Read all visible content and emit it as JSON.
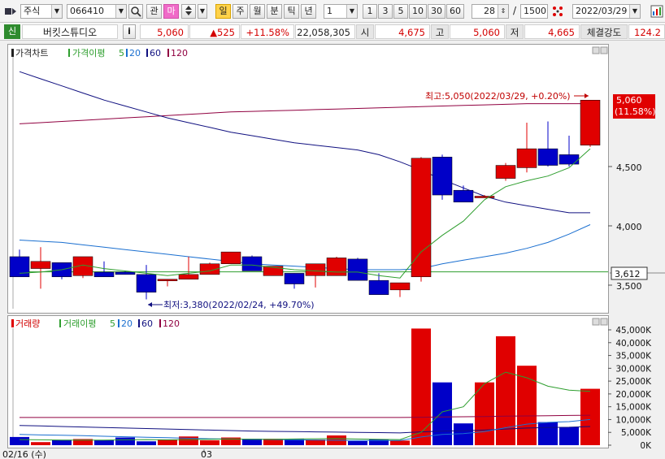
{
  "toolbar": {
    "market": "주식",
    "code": "066410",
    "btn_gwan": "관",
    "btn_ma": "마",
    "btn_day": "일",
    "btn_week": "주",
    "btn_month": "월",
    "btn_min": "분",
    "btn_tick": "틱",
    "btn_year": "년",
    "period_select": "1",
    "periods": [
      "1",
      "3",
      "5",
      "10",
      "30",
      "60"
    ],
    "count": "28",
    "slash": "/",
    "total": "1500",
    "date": "2022/03/29"
  },
  "info": {
    "badge": "신",
    "name": "버킷스튜디오",
    "info_btn": "i",
    "price": "5,060",
    "change": "▲525",
    "change_pct": "+11.58%",
    "volume": "22,058,305",
    "open_label": "시",
    "open": "4,675",
    "high_label": "고",
    "high": "5,060",
    "low_label": "저",
    "low": "4,665",
    "strength_label": "체결강도",
    "strength": "124.2"
  },
  "price_panel": {
    "title": "가격차트",
    "ma_label": "가격이평",
    "ma5": "5",
    "ma20": "20",
    "ma60": "60",
    "ma120": "120",
    "max_annotation": "최고:5,050(2022/03/29, +0.20%)",
    "min_annotation": "최저:3,380(2022/02/24, +49.70%)",
    "current_price_tag": "5,060",
    "current_pct_tag": "(11.58%)",
    "ref_price_tag": "3,612",
    "y_ticks": [
      "4,500",
      "4,000",
      "3,500"
    ]
  },
  "volume_panel": {
    "title": "거래량",
    "ma_label": "거래이평",
    "ma5": "5",
    "ma20": "20",
    "ma60": "60",
    "ma120": "120",
    "y_ticks": [
      "45,000K",
      "40,000K",
      "35,000K",
      "30,000K",
      "25,000K",
      "20,000K",
      "15,000K",
      "10,000K",
      "5,000K",
      "0K"
    ]
  },
  "x_axis": {
    "start_label": "02/16 (수)",
    "month_label": "03"
  },
  "colors": {
    "up": "#e00000",
    "down": "#0000c8",
    "ma5": "#2e9e2e",
    "ma20": "#1a6fd0",
    "ma60": "#101080",
    "ma120": "#900040"
  },
  "chart_data": {
    "type": "candlestick",
    "candles": [
      {
        "o": 3740,
        "h": 3800,
        "l": 3580,
        "c": 3570
      },
      {
        "o": 3640,
        "h": 3820,
        "l": 3470,
        "c": 3700
      },
      {
        "o": 3690,
        "h": 3690,
        "l": 3550,
        "c": 3570
      },
      {
        "o": 3580,
        "h": 3740,
        "l": 3560,
        "c": 3740
      },
      {
        "o": 3610,
        "h": 3700,
        "l": 3570,
        "c": 3570
      },
      {
        "o": 3610,
        "h": 3620,
        "l": 3590,
        "c": 3590
      },
      {
        "o": 3590,
        "h": 3670,
        "l": 3380,
        "c": 3440
      },
      {
        "o": 3550,
        "h": 3550,
        "l": 3490,
        "c": 3550
      },
      {
        "o": 3550,
        "h": 3740,
        "l": 3550,
        "c": 3590
      },
      {
        "o": 3590,
        "h": 3690,
        "l": 3590,
        "c": 3680
      },
      {
        "o": 3680,
        "h": 3780,
        "l": 3680,
        "c": 3780
      },
      {
        "o": 3740,
        "h": 3750,
        "l": 3620,
        "c": 3620
      },
      {
        "o": 3580,
        "h": 3660,
        "l": 3580,
        "c": 3660
      },
      {
        "o": 3600,
        "h": 3600,
        "l": 3470,
        "c": 3510
      },
      {
        "o": 3580,
        "h": 3680,
        "l": 3480,
        "c": 3680
      },
      {
        "o": 3580,
        "h": 3740,
        "l": 3580,
        "c": 3730
      },
      {
        "o": 3720,
        "h": 3730,
        "l": 3540,
        "c": 3540
      },
      {
        "o": 3540,
        "h": 3600,
        "l": 3420,
        "c": 3420
      },
      {
        "o": 3460,
        "h": 3520,
        "l": 3400,
        "c": 3520
      },
      {
        "o": 3570,
        "h": 4580,
        "l": 3530,
        "c": 4570
      },
      {
        "o": 4580,
        "h": 4600,
        "l": 4220,
        "c": 4260
      },
      {
        "o": 4300,
        "h": 4340,
        "l": 4200,
        "c": 4200
      },
      {
        "o": 4250,
        "h": 4260,
        "l": 4240,
        "c": 4250
      },
      {
        "o": 4400,
        "h": 4530,
        "l": 4380,
        "c": 4510
      },
      {
        "o": 4490,
        "h": 4870,
        "l": 4450,
        "c": 4650
      },
      {
        "o": 4650,
        "h": 4880,
        "l": 4500,
        "c": 4510
      },
      {
        "o": 4600,
        "h": 4760,
        "l": 4500,
        "c": 4520
      },
      {
        "o": 4680,
        "h": 5060,
        "l": 4665,
        "c": 5060
      }
    ],
    "volumes": [
      3200,
      1200,
      2100,
      2400,
      2000,
      3000,
      1500,
      2100,
      3400,
      1900,
      3000,
      2500,
      2500,
      2400,
      2200,
      3800,
      1600,
      2300,
      1800,
      45500,
      24500,
      8500,
      24500,
      42500,
      31000,
      9000,
      7000,
      22000
    ],
    "ma5": [
      3600,
      3610,
      3630,
      3670,
      3640,
      3620,
      3600,
      3580,
      3600,
      3620,
      3670,
      3670,
      3650,
      3630,
      3620,
      3610,
      3610,
      3580,
      3560,
      3780,
      3920,
      4040,
      4220,
      4330,
      4380,
      4420,
      4490,
      4650
    ],
    "ma20": [
      3880,
      3870,
      3860,
      3840,
      3820,
      3800,
      3780,
      3760,
      3740,
      3720,
      3700,
      3680,
      3670,
      3660,
      3650,
      3640,
      3630,
      3630,
      3630,
      3640,
      3680,
      3710,
      3740,
      3770,
      3810,
      3860,
      3930,
      4010
    ],
    "ma60": [
      5300,
      5240,
      5180,
      5120,
      5060,
      5010,
      4960,
      4910,
      4870,
      4830,
      4790,
      4760,
      4730,
      4700,
      4680,
      4660,
      4640,
      4600,
      4540,
      4470,
      4390,
      4320,
      4250,
      4200,
      4170,
      4140,
      4110,
      4110
    ],
    "ma120": [
      4860,
      4870,
      4880,
      4890,
      4900,
      4910,
      4920,
      4930,
      4940,
      4950,
      4960,
      4965,
      4970,
      4975,
      4980,
      4985,
      4990,
      4995,
      5000,
      5005,
      5010,
      5015,
      5020,
      5025,
      5030,
      5030,
      5030,
      5030
    ],
    "vol_ma5": [
      2200,
      2100,
      2000,
      2000,
      2000,
      2100,
      2200,
      2100,
      2200,
      2300,
      2400,
      2300,
      2300,
      2400,
      2500,
      2600,
      2400,
      2300,
      2200,
      5000,
      13000,
      15000,
      24000,
      28500,
      26300,
      23000,
      21500,
      21000
    ],
    "vol_ma20": [
      4200,
      4000,
      3900,
      3700,
      3500,
      3300,
      3100,
      2900,
      2700,
      2500,
      2400,
      2300,
      2200,
      2100,
      2000,
      1900,
      1800,
      1800,
      1800,
      3200,
      4200,
      4500,
      5300,
      6800,
      8200,
      8900,
      9200,
      10000
    ],
    "vol_ma60": [
      7700,
      7500,
      7300,
      7100,
      6900,
      6700,
      6500,
      6300,
      6100,
      5900,
      5700,
      5500,
      5400,
      5300,
      5200,
      5100,
      5000,
      4900,
      4800,
      5200,
      5500,
      5600,
      5900,
      6300,
      6700,
      6900,
      7000,
      7300
    ],
    "vol_ma120": [
      10800,
      10800,
      10800,
      10800,
      10800,
      10800,
      10800,
      10800,
      10800,
      10800,
      10800,
      10800,
      10800,
      10800,
      10800,
      10800,
      10800,
      10800,
      10800,
      10900,
      11000,
      11100,
      11200,
      11300,
      11400,
      11500,
      11600,
      11700
    ]
  }
}
